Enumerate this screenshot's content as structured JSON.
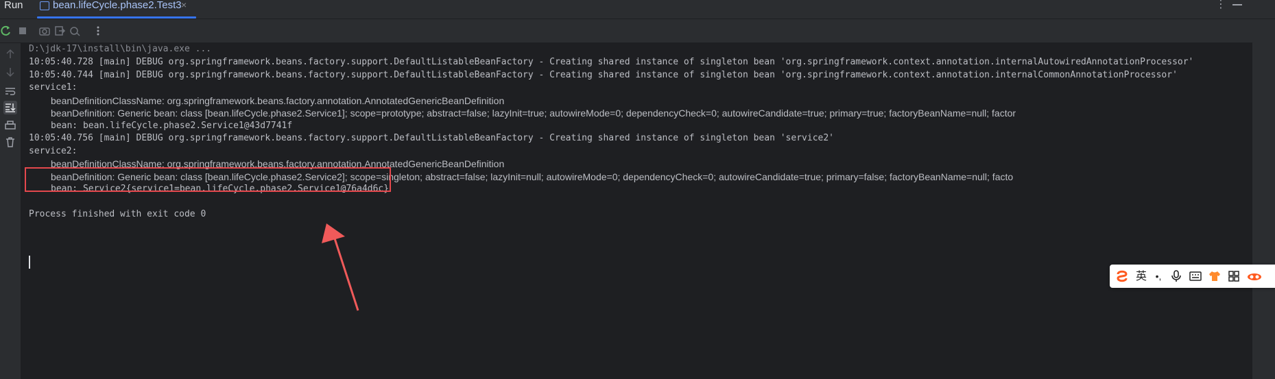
{
  "header": {
    "run_label": "Run",
    "tab_title": "bean.lifeCycle.phase2.Test3",
    "tab_close": "×",
    "menu_glyph": "⋮"
  },
  "toolbar": {
    "icons": [
      "rerun-icon",
      "stop-icon",
      "screenshot-icon",
      "exit-icon",
      "restart-debug-icon",
      "more-icon"
    ]
  },
  "sidebar": {
    "icons": [
      "up-arrow-icon",
      "down-arrow-icon",
      "soft-wrap-icon",
      "scroll-to-end-icon",
      "print-icon",
      "trash-icon"
    ]
  },
  "console": {
    "lines": [
      "D:\\jdk-17\\install\\bin\\java.exe ...",
      "10:05:40.728 [main] DEBUG org.springframework.beans.factory.support.DefaultListableBeanFactory - Creating shared instance of singleton bean 'org.springframework.context.annotation.internalAutowiredAnnotationProcessor'",
      "10:05:40.744 [main] DEBUG org.springframework.beans.factory.support.DefaultListableBeanFactory - Creating shared instance of singleton bean 'org.springframework.context.annotation.internalCommonAnnotationProcessor'",
      "service1:",
      "beanDefinitionClassName: org.springframework.beans.factory.annotation.AnnotatedGenericBeanDefinition",
      "beanDefinition: Generic bean: class [bean.lifeCycle.phase2.Service1]; scope=prototype; abstract=false; lazyInit=true; autowireMode=0; dependencyCheck=0; autowireCandidate=true; primary=true; factoryBeanName=null; factor",
      "bean: bean.lifeCycle.phase2.Service1@43d7741f",
      "10:05:40.756 [main] DEBUG org.springframework.beans.factory.support.DefaultListableBeanFactory - Creating shared instance of singleton bean 'service2'",
      "service2:",
      "beanDefinitionClassName: org.springframework.beans.factory.annotation.AnnotatedGenericBeanDefinition",
      "beanDefinition: Generic bean: class [bean.lifeCycle.phase2.Service2]; scope=singleton; abstract=false; lazyInit=null; autowireMode=0; dependencyCheck=0; autowireCandidate=true; primary=false; factoryBeanName=null; facto",
      "bean: Service2{service1=bean.lifeCycle.phase2.Service1@76a4d6c}",
      "Process finished with exit code 0"
    ]
  },
  "ime_toolbar": {
    "items": [
      "S",
      "英",
      "•,",
      "mic-icon",
      "keyboard-icon",
      "shirt-icon",
      "grid-icon",
      "goggles-icon"
    ],
    "lang_label": "英",
    "punct_label": "•,",
    "brand_color": "#ff5a1f"
  },
  "annotation": {
    "box_color": "#e5484d",
    "arrow_color": "#f05a5a"
  }
}
